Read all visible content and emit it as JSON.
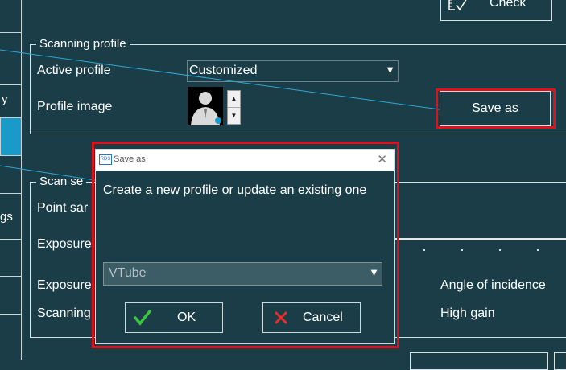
{
  "check_button": {
    "label": "Check"
  },
  "scanning_profile": {
    "title": "Scanning profile",
    "active_profile_label": "Active profile",
    "active_profile_value": "Customized",
    "profile_image_label": "Profile image",
    "save_as_label": "Save as"
  },
  "scan_settings": {
    "title_partial": "Scan se",
    "point_label_partial": "Point sar",
    "exposure1_partial": "Exposure",
    "exposure2_partial": "Exposure",
    "scanning_partial": "Scanning",
    "angle_label": "Angle of incidence",
    "gain_label": "High gain"
  },
  "left_strip": {
    "item1": "y",
    "item2": "gs"
  },
  "dialog": {
    "title": "Save as",
    "app_icon_text": "RDS",
    "message": "Create a new profile or update an existing one",
    "select_value": "VTube",
    "ok_label": "OK",
    "cancel_label": "Cancel"
  },
  "colors": {
    "background": "#1a3d47",
    "highlight": "#e0101a",
    "accent": "#1a9ac8"
  },
  "icons": [
    "ruler-check-icon",
    "dropdown-arrow-icon",
    "profile-avatar-icon",
    "spinner-arrows-icon",
    "close-icon",
    "check-icon",
    "cross-icon"
  ]
}
